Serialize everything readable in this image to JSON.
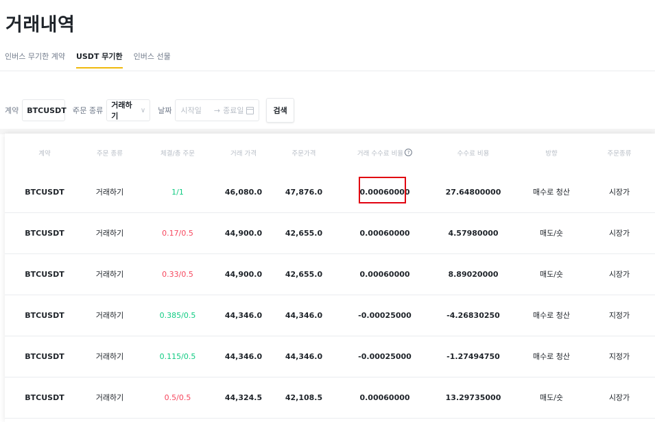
{
  "page": {
    "title": "거래내역",
    "tabs": [
      "인버스 무기한 계약",
      "USDT 무기한",
      "인버스 선물"
    ],
    "active_tab": "USDT 무기한"
  },
  "filters": {
    "contract_label": "계약",
    "contract_value": "BTCUSDT",
    "order_type_label": "주문 종류",
    "order_type_value": "거래하기",
    "date_label": "날짜",
    "start_placeholder": "시작일",
    "end_placeholder": "종료일",
    "search_label": "검색"
  },
  "table": {
    "headers": [
      "계약",
      "주문 종류",
      "체결/총 주문",
      "거래 가격",
      "주문가격",
      "거래 수수료 비율",
      "수수료 비용",
      "방향",
      "주문종류"
    ],
    "rows": [
      {
        "symbol": "BTCUSDT",
        "order_kind": "거래하기",
        "filled": "1/1",
        "filled_color": "green",
        "trade_price": "46,080.0",
        "order_price": "47,876.0",
        "fee_rate": "0.00060000",
        "fee_cost": "27.64800000",
        "direction": "매수로 청산",
        "order_type": "시장가"
      },
      {
        "symbol": "BTCUSDT",
        "order_kind": "거래하기",
        "filled": "0.17/0.5",
        "filled_color": "red",
        "trade_price": "44,900.0",
        "order_price": "42,655.0",
        "fee_rate": "0.00060000",
        "fee_cost": "4.57980000",
        "direction": "매도/숏",
        "order_type": "시장가"
      },
      {
        "symbol": "BTCUSDT",
        "order_kind": "거래하기",
        "filled": "0.33/0.5",
        "filled_color": "red",
        "trade_price": "44,900.0",
        "order_price": "42,655.0",
        "fee_rate": "0.00060000",
        "fee_cost": "8.89020000",
        "direction": "매도/숏",
        "order_type": "시장가"
      },
      {
        "symbol": "BTCUSDT",
        "order_kind": "거래하기",
        "filled": "0.385/0.5",
        "filled_color": "green",
        "trade_price": "44,346.0",
        "order_price": "44,346.0",
        "fee_rate": "-0.00025000",
        "fee_cost": "-4.26830250",
        "direction": "매수로 청산",
        "order_type": "지정가"
      },
      {
        "symbol": "BTCUSDT",
        "order_kind": "거래하기",
        "filled": "0.115/0.5",
        "filled_color": "green",
        "trade_price": "44,346.0",
        "order_price": "44,346.0",
        "fee_rate": "-0.00025000",
        "fee_cost": "-1.27494750",
        "direction": "매수로 청산",
        "order_type": "지정가"
      },
      {
        "symbol": "BTCUSDT",
        "order_kind": "거래하기",
        "filled": "0.5/0.5",
        "filled_color": "red",
        "trade_price": "44,324.5",
        "order_price": "42,108.5",
        "fee_rate": "0.00060000",
        "fee_cost": "13.29735000",
        "direction": "매도/숏",
        "order_type": "시장가"
      }
    ]
  },
  "colors": {
    "accent": "#f0b90b",
    "green": "#0ecb81",
    "red": "#f6465d",
    "highlight": "#e1000f"
  }
}
